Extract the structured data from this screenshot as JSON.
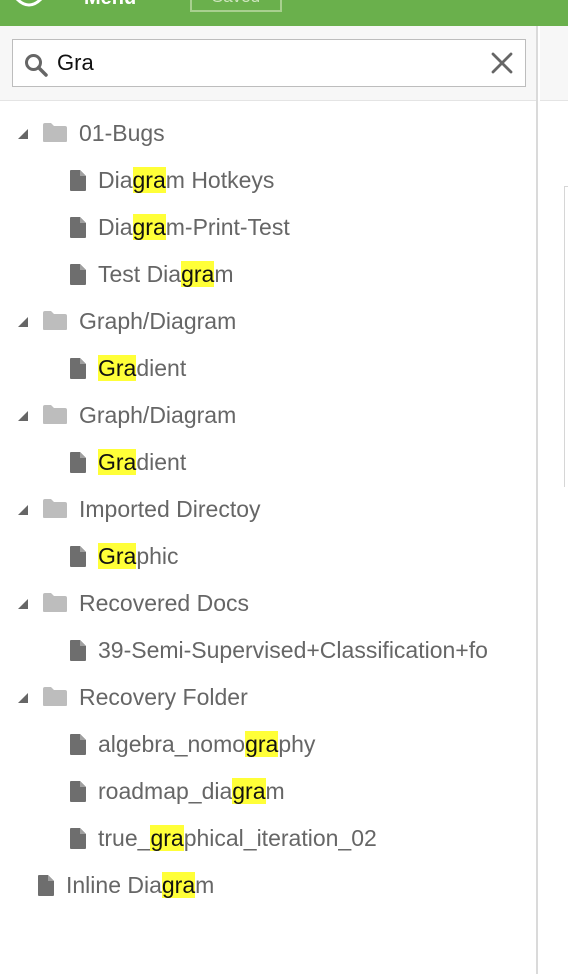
{
  "topbar": {
    "menu_label": "Menu",
    "saved_label": "Saved",
    "color": "#6ab04c"
  },
  "search": {
    "value": "Gra",
    "highlight_color": "#ffff38"
  },
  "tree": [
    {
      "type": "folder",
      "level": 0,
      "label": "01-Bugs",
      "expanded": true
    },
    {
      "type": "file",
      "level": 1,
      "pre": "Dia",
      "match": "gra",
      "post": "m Hotkeys"
    },
    {
      "type": "file",
      "level": 1,
      "pre": "Dia",
      "match": "gra",
      "post": "m-Print-Test"
    },
    {
      "type": "file",
      "level": 1,
      "pre": "Test Dia",
      "match": "gra",
      "post": "m"
    },
    {
      "type": "folder",
      "level": 0,
      "label": "Graph/Diagram",
      "expanded": true
    },
    {
      "type": "file",
      "level": 1,
      "pre": "",
      "match": "Gra",
      "post": "dient"
    },
    {
      "type": "folder",
      "level": 0,
      "label": "Graph/Diagram",
      "expanded": true
    },
    {
      "type": "file",
      "level": 1,
      "pre": "",
      "match": "Gra",
      "post": "dient"
    },
    {
      "type": "folder",
      "level": 0,
      "label": "Imported Directoy",
      "expanded": true
    },
    {
      "type": "file",
      "level": 1,
      "pre": "",
      "match": "Gra",
      "post": "phic"
    },
    {
      "type": "folder",
      "level": 0,
      "label": "Recovered Docs",
      "expanded": true
    },
    {
      "type": "file",
      "level": 1,
      "pre": "39-Semi-Supervised+Classification+fo",
      "match": "",
      "post": ""
    },
    {
      "type": "folder",
      "level": 0,
      "label": "Recovery Folder",
      "expanded": true
    },
    {
      "type": "file",
      "level": 1,
      "pre": "algebra_nomo",
      "match": "gra",
      "post": "phy"
    },
    {
      "type": "file",
      "level": 1,
      "pre": "roadmap_dia",
      "match": "gra",
      "post": "m"
    },
    {
      "type": "file",
      "level": 1,
      "pre": "true_",
      "match": "gra",
      "post": "phical_iteration_02"
    },
    {
      "type": "file",
      "level": -1,
      "pre": "Inline Dia",
      "match": "gra",
      "post": "m"
    }
  ]
}
